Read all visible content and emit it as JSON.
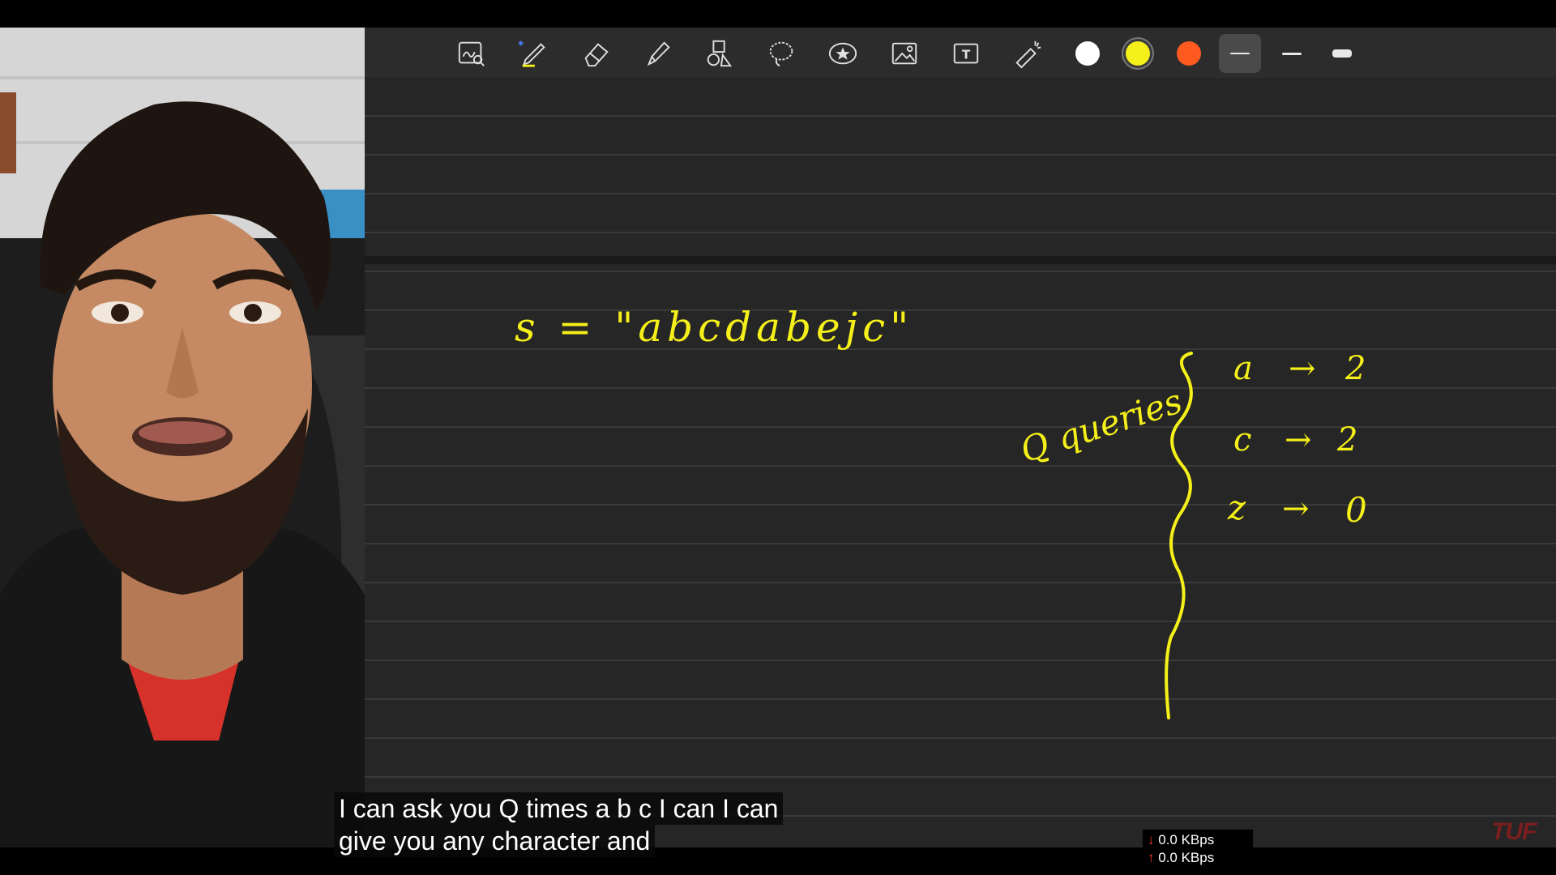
{
  "toolbar": {
    "tools": [
      {
        "name": "lasso-screenshot-icon"
      },
      {
        "name": "pen-icon"
      },
      {
        "name": "eraser-icon"
      },
      {
        "name": "highlighter-icon"
      },
      {
        "name": "shapes-icon"
      },
      {
        "name": "lasso-select-icon"
      },
      {
        "name": "sticker-icon"
      },
      {
        "name": "image-icon"
      },
      {
        "name": "text-tool-icon"
      },
      {
        "name": "laser-pointer-icon"
      }
    ],
    "colors": [
      "#ffffff",
      "#f5f019",
      "#ff5a1f"
    ],
    "selected_color": "#f5f019"
  },
  "note": {
    "string_line": "s = \"abcdabejc\"",
    "queries_label": "Q queries",
    "mappings": [
      {
        "char": "a",
        "arrow": "→",
        "count": "2"
      },
      {
        "char": "c",
        "arrow": "→",
        "count": "2"
      },
      {
        "char": "z",
        "arrow": "→",
        "count": "0"
      }
    ],
    "ink_color": "#f5f019"
  },
  "captions": {
    "line1": "I can ask you Q times a b c I can I can",
    "line2": "give you any character and"
  },
  "netmeter": {
    "down": "0.0 KBps",
    "up": "0.0 KBps"
  },
  "brand": "TUF"
}
